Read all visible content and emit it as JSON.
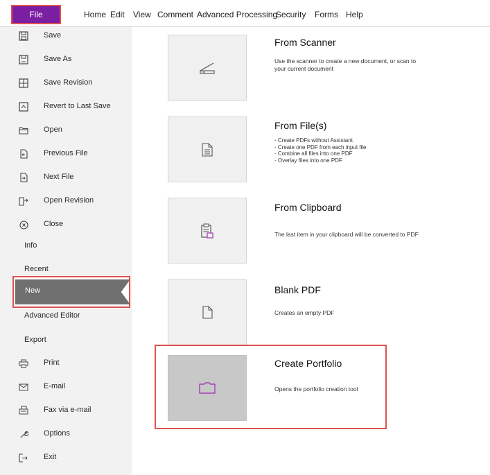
{
  "menubar": {
    "file": "File",
    "items": [
      "Home",
      "Edit",
      "View",
      "Comment",
      "Advanced Processing",
      "Security",
      "Forms",
      "Help"
    ]
  },
  "sidebar": {
    "items": [
      {
        "label": "Save",
        "icon": "save-icon"
      },
      {
        "label": "Save As",
        "icon": "save-as-icon"
      },
      {
        "label": "Save Revision",
        "icon": "save-revision-icon"
      },
      {
        "label": "Revert to Last Save",
        "icon": "revert-icon"
      },
      {
        "label": "Open",
        "icon": "folder-open-icon"
      },
      {
        "label": "Previous File",
        "icon": "previous-file-icon"
      },
      {
        "label": "Next File",
        "icon": "next-file-icon"
      },
      {
        "label": "Open Revision",
        "icon": "open-revision-icon"
      },
      {
        "label": "Close",
        "icon": "close-circle-icon"
      },
      {
        "label": "Info"
      },
      {
        "label": "Recent"
      },
      {
        "label": "New"
      },
      {
        "label": "Advanced Editor"
      },
      {
        "label": "Export"
      },
      {
        "label": "Print",
        "icon": "printer-icon"
      },
      {
        "label": "E-mail",
        "icon": "envelope-icon"
      },
      {
        "label": "Fax via e-mail",
        "icon": "fax-icon"
      },
      {
        "label": "Options",
        "icon": "wrench-icon"
      },
      {
        "label": "Exit",
        "icon": "exit-icon"
      }
    ]
  },
  "options": [
    {
      "title": "From Scanner",
      "icon": "scanner-icon",
      "description": [
        "Use the scanner to create a new document, or scan to",
        "your current document"
      ]
    },
    {
      "title": "From File(s)",
      "icon": "document-icon",
      "description": [
        "- Create PDFs without Assistant",
        "- Create one PDF from each input file",
        "- Combine all files into one PDF",
        "- Overlay files into one PDF"
      ]
    },
    {
      "title": "From Clipboard",
      "icon": "clipboard-icon",
      "description": [
        "The last item in your clipboard will be converted to PDF"
      ]
    },
    {
      "title": "Blank PDF",
      "icon": "blank-page-icon",
      "description": [
        "Creates an empty PDF"
      ]
    },
    {
      "title": "Create Portfolio",
      "icon": "portfolio-folder-icon",
      "description": [
        "Opens the portfolio creation tool"
      ]
    }
  ],
  "colors": {
    "file_tab": "#7b1fa2",
    "accent_icon": "#9c27b0",
    "highlight_outline": "#e05050",
    "selected_nav": "#6f6f6f"
  }
}
